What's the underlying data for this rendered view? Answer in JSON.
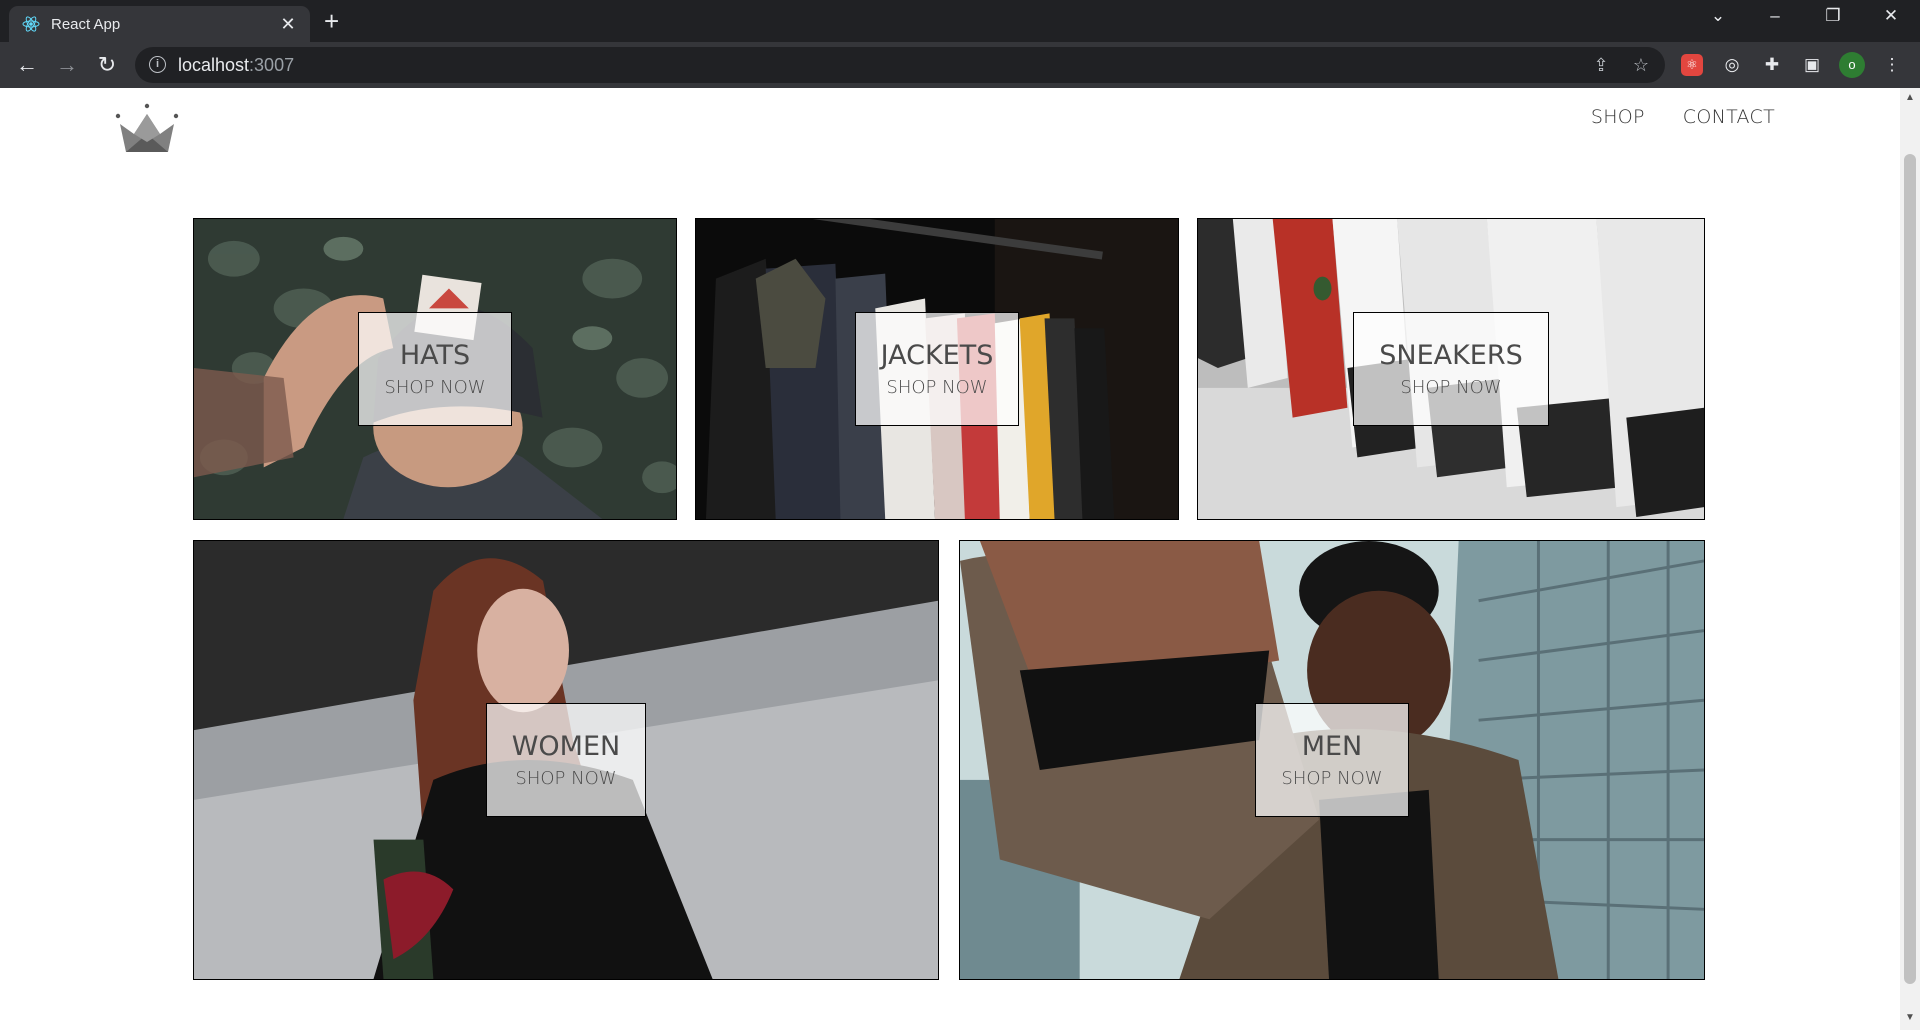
{
  "browser": {
    "tab_title": "React App",
    "tab_close": "✕",
    "new_tab": "+",
    "url_host": "localhost",
    "url_port": ":3007",
    "window_controls": [
      "⌄",
      "–",
      "❐",
      "✕"
    ],
    "profile_initial": "o"
  },
  "header": {
    "logo": "crown-icon",
    "nav": [
      "SHOP",
      "CONTACT"
    ]
  },
  "directory": {
    "sections": [
      {
        "title": "HATS",
        "subtitle": "SHOP NOW",
        "image": "hats-photo"
      },
      {
        "title": "JACKETS",
        "subtitle": "SHOP NOW",
        "image": "jackets-photo"
      },
      {
        "title": "SNEAKERS",
        "subtitle": "SHOP NOW",
        "image": "sneakers-photo"
      },
      {
        "title": "WOMEN",
        "subtitle": "SHOP NOW",
        "image": "women-photo"
      },
      {
        "title": "MEN",
        "subtitle": "SHOP NOW",
        "image": "men-photo"
      }
    ]
  },
  "colors": {
    "chrome_dark": "#202124",
    "chrome_tab": "#35363a",
    "border": "#000000",
    "text": "#4a4a4a"
  }
}
